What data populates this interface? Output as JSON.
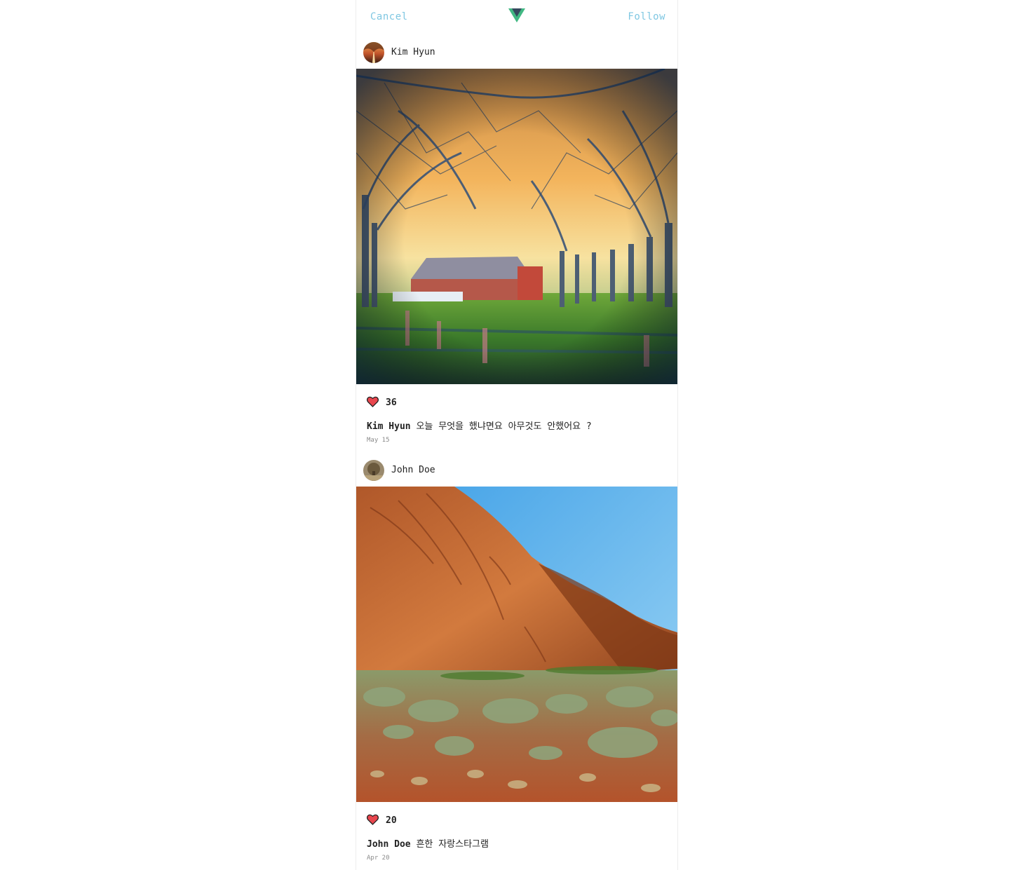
{
  "header": {
    "cancel_label": "Cancel",
    "follow_label": "Follow",
    "logo_icon": "vue-logo-icon",
    "accent_color": "#7fc7e2"
  },
  "posts": [
    {
      "username": "Kim Hyun",
      "avatar_icon": "avatar-photo-icon",
      "photo": "orchard-with-barn-photo",
      "likes": "36",
      "caption_user": "Kim Hyun",
      "caption_text": "오늘 무엇을 했냐면요 아무것도 안했어요 ?",
      "date": "May 15"
    },
    {
      "username": "John Doe",
      "avatar_icon": "avatar-photo-icon",
      "photo": "red-rock-desert-photo",
      "likes": "20",
      "caption_user": "John Doe",
      "caption_text": "흔한 자랑스타그램",
      "date": "Apr 20"
    }
  ],
  "colors": {
    "heart": "#e8464e",
    "text": "#222222",
    "date": "#8a8a8a"
  }
}
